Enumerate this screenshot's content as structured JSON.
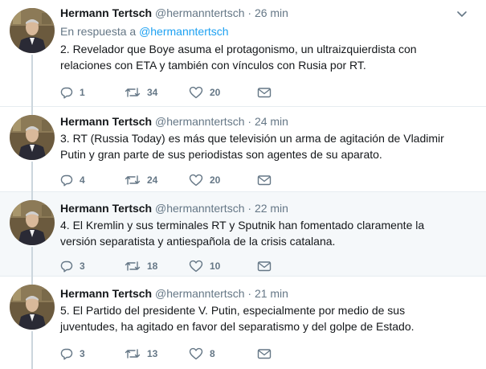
{
  "tweets": [
    {
      "name": "Hermann Tertsch",
      "handle": "@hermanntertsch",
      "separator": "·",
      "time": "26 min",
      "reply_prefix": "En respuesta a",
      "reply_handle": "@hermanntertsch",
      "text": "2. Revelador que Boye asuma el protagonismo, un ultraizquierdista con relaciones con ETA y también con vínculos con Rusia por RT.",
      "replies": "1",
      "retweets": "34",
      "likes": "20",
      "highlighted": false
    },
    {
      "name": "Hermann Tertsch",
      "handle": "@hermanntertsch",
      "separator": "·",
      "time": "24 min",
      "text": "3. RT (Russia Today) es más que televisión un arma de agitación de Vladimir Putin y gran parte de sus periodistas son agentes de su aparato.",
      "replies": "4",
      "retweets": "24",
      "likes": "20",
      "highlighted": false
    },
    {
      "name": "Hermann Tertsch",
      "handle": "@hermanntertsch",
      "separator": "·",
      "time": "22 min",
      "text": "4. El Kremlin y sus terminales RT y Sputnik han fomentado claramente la versión separatista y antiespañola de la crisis catalana.",
      "replies": "3",
      "retweets": "18",
      "likes": "10",
      "highlighted": true
    },
    {
      "name": "Hermann Tertsch",
      "handle": "@hermanntertsch",
      "separator": "·",
      "time": "21 min",
      "text": "5. El Partido del presidente V. Putin, especialmente por medio de sus juventudes, ha agitado en favor del separatismo y del golpe de Estado.",
      "replies": "3",
      "retweets": "13",
      "likes": "8",
      "highlighted": false
    }
  ],
  "colors": {
    "text": "#14171a",
    "secondary": "#657786",
    "link": "#1da1f2",
    "highlight_bg": "#f5f8fa",
    "divider": "#e6ecf0",
    "thread_line": "#ccd6dd"
  },
  "icons": {
    "avatar": "avatar-photo",
    "reply": "reply-icon",
    "retweet": "retweet-icon",
    "like": "heart-icon",
    "message": "envelope-icon",
    "menu": "chevron-down-icon"
  }
}
